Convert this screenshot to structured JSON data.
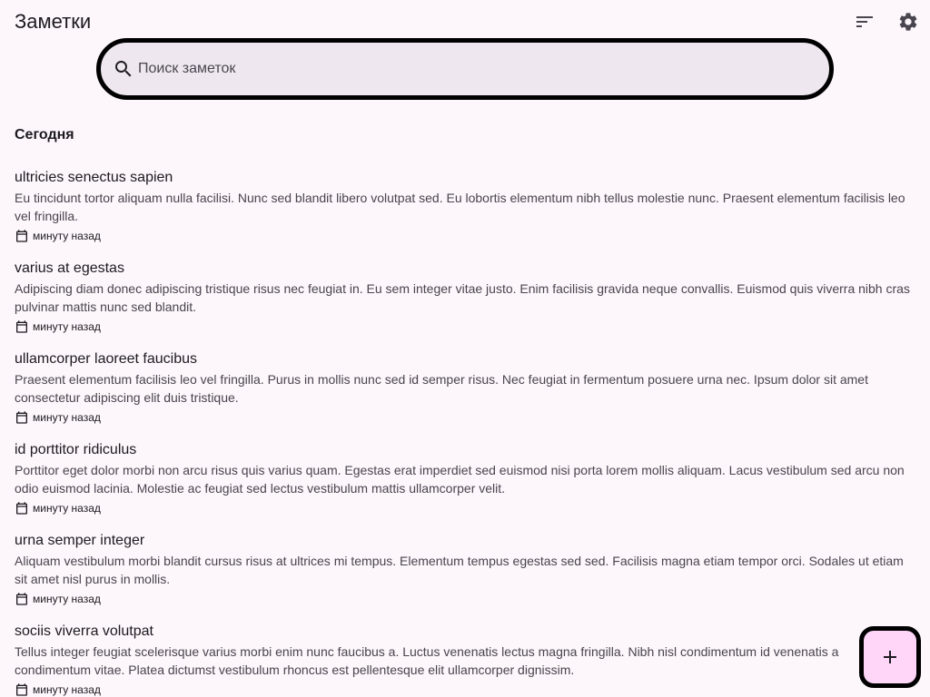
{
  "appbar": {
    "title": "Заметки",
    "sort_icon": "sort-icon",
    "settings_icon": "gear-icon"
  },
  "search": {
    "placeholder": "Поиск заметок",
    "value": "",
    "icon": "search-icon"
  },
  "section": {
    "title": "Сегодня"
  },
  "notes": [
    {
      "title": "ultricies senectus sapien",
      "body": "Eu tincidunt tortor aliquam nulla facilisi. Nunc sed blandit libero volutpat sed. Eu lobortis elementum nibh tellus molestie nunc. Praesent elementum facilisis leo vel fringilla.",
      "date": "минуту назад"
    },
    {
      "title": "varius at egestas",
      "body": "Adipiscing diam donec adipiscing tristique risus nec feugiat in. Eu sem integer vitae justo. Enim facilisis gravida neque convallis. Euismod quis viverra nibh cras pulvinar mattis nunc sed blandit.",
      "date": "минуту назад"
    },
    {
      "title": "ullamcorper laoreet faucibus",
      "body": "Praesent elementum facilisis leo vel fringilla. Purus in mollis nunc sed id semper risus. Nec feugiat in fermentum posuere urna nec. Ipsum dolor sit amet consectetur adipiscing elit duis tristique.",
      "date": "минуту назад"
    },
    {
      "title": "id porttitor ridiculus",
      "body": "Porttitor eget dolor morbi non arcu risus quis varius quam. Egestas erat imperdiet sed euismod nisi porta lorem mollis aliquam. Lacus vestibulum sed arcu non odio euismod lacinia. Molestie ac feugiat sed lectus vestibulum mattis ullamcorper velit.",
      "date": "минуту назад"
    },
    {
      "title": "urna semper integer",
      "body": "Aliquam vestibulum morbi blandit cursus risus at ultrices mi tempus. Elementum tempus egestas sed sed. Facilisis magna etiam tempor orci. Sodales ut etiam sit amet nisl purus in mollis.",
      "date": "минуту назад"
    },
    {
      "title": "sociis viverra volutpat",
      "body": "Tellus integer feugiat scelerisque varius morbi enim nunc faucibus a. Luctus venenatis lectus magna fringilla. Nibh nisl condimentum id venenatis a condimentum vitae. Platea dictumst vestibulum rhoncus est pellentesque elit ullamcorper dignissim.",
      "date": "минуту назад"
    }
  ],
  "fab": {
    "icon": "plus-icon"
  },
  "colors": {
    "background": "#fdf6fa",
    "search_fill": "#efe7ef",
    "fab_fill": "#ffd6f8",
    "outline": "#000000",
    "icon": "#49454f"
  }
}
